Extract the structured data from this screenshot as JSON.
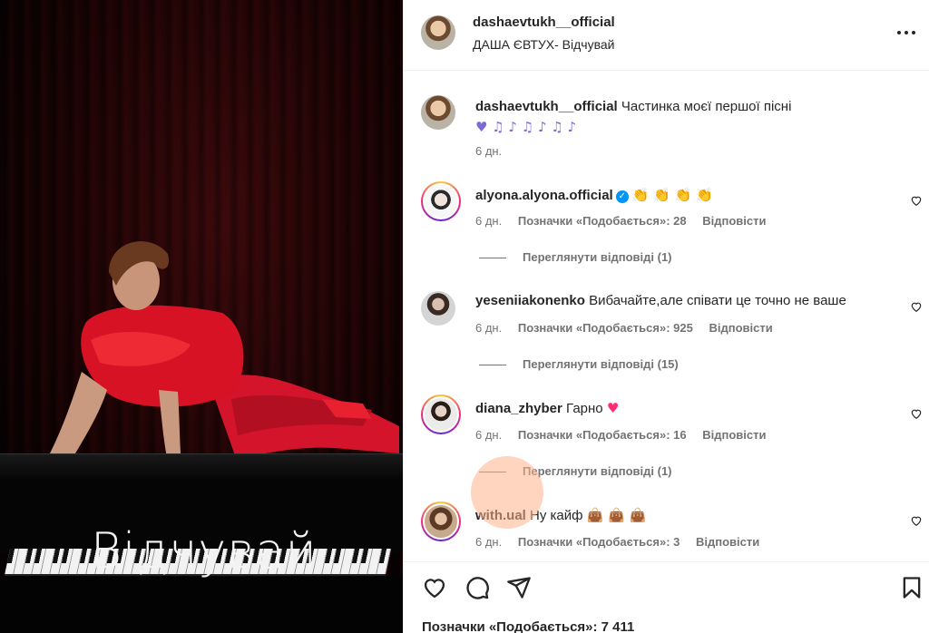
{
  "media": {
    "overlay_text": "Відчувай"
  },
  "header": {
    "username": "dashaevtukh__official",
    "subtitle": "ДАША ЄВТУХ- Відчувай"
  },
  "caption": {
    "username": "dashaevtukh__official",
    "text": "Частинка моєї першої пісні",
    "emojis": "♥ ♫ ♪ ♫ ♪ ♫ ♪",
    "time": "6 дн."
  },
  "comments": [
    {
      "username": "alyona.alyona.official",
      "verified": true,
      "text": "",
      "emojis": "👏 👏 👏 👏",
      "time": "6 дн.",
      "likes": "Позначки «Подобається»: 28",
      "reply": "Відповісти",
      "view_replies": "Переглянути відповіді (1)"
    },
    {
      "username": "yeseniiakonenko",
      "verified": false,
      "text": "Вибачайте,але співати це точно не ваше",
      "emojis": "",
      "time": "6 дн.",
      "likes": "Позначки «Подобається»: 925",
      "reply": "Відповісти",
      "view_replies": "Переглянути відповіді (15)"
    },
    {
      "username": "diana_zhyber",
      "verified": false,
      "text": "Гарно",
      "emojis": "♥",
      "time": "6 дн.",
      "likes": "Позначки «Подобається»: 16",
      "reply": "Відповісти",
      "view_replies": "Переглянути відповіді (1)"
    },
    {
      "username": "with.ual",
      "verified": false,
      "text": "Ну кайф",
      "emojis": "👜 👜 👜",
      "time": "6 дн.",
      "likes": "Позначки «Подобається»: 3",
      "reply": "Відповісти",
      "view_replies": ""
    }
  ],
  "footer": {
    "likes": "Позначки «Подобається»: 7 411"
  },
  "icons": {
    "more": "more-options-icon",
    "like": "heart-icon",
    "comment": "comment-icon",
    "share": "send-icon",
    "save": "bookmark-icon"
  }
}
